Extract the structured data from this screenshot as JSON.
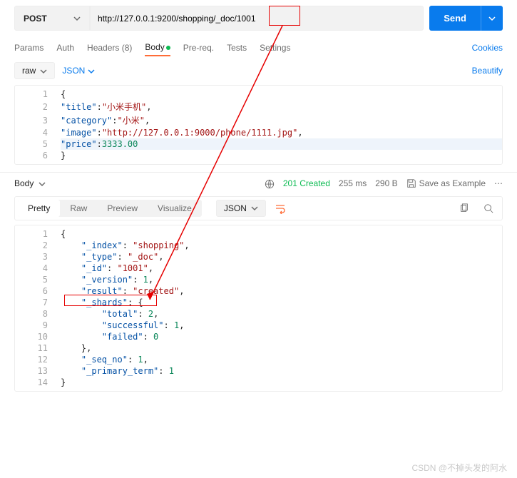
{
  "request": {
    "method": "POST",
    "url": "http://127.0.0.1:9200/shopping/_doc/1001",
    "send_label": "Send"
  },
  "tabs": {
    "params": "Params",
    "auth": "Auth",
    "headers": "Headers (8)",
    "body": "Body",
    "pre": "Pre-req.",
    "tests": "Tests",
    "settings": "Settings",
    "cookies": "Cookies"
  },
  "body_controls": {
    "mode": "raw",
    "lang": "JSON",
    "beautify": "Beautify"
  },
  "request_body_lines": {
    "l1": "{",
    "l2a": "\"title\"",
    "l2b": ":",
    "l2c": "\"小米手机\"",
    "l2d": ",",
    "l3a": "\"category\"",
    "l3b": ":",
    "l3c": "\"小米\"",
    "l3d": ",",
    "l4a": "\"image\"",
    "l4b": ":",
    "l4c": "\"http://127.0.0.1:9000/phone/1111.jpg\"",
    "l4d": ",",
    "l5a": "\"price\"",
    "l5b": ":",
    "l5c": "3333.00",
    "l6": "}"
  },
  "response": {
    "section": "Body",
    "status": "201 Created",
    "time": "255 ms",
    "size": "290 B",
    "save_example": "Save as Example"
  },
  "resp_tabs": {
    "pretty": "Pretty",
    "raw": "Raw",
    "preview": "Preview",
    "visualize": "Visualize",
    "format": "JSON"
  },
  "response_lines": {
    "l1": "{",
    "l2a": "    ",
    "l2b": "\"_index\"",
    "l2c": ": ",
    "l2d": "\"shopping\"",
    "l2e": ",",
    "l3a": "    ",
    "l3b": "\"_type\"",
    "l3c": ": ",
    "l3d": "\"_doc\"",
    "l3e": ",",
    "l4a": "    ",
    "l4b": "\"_id\"",
    "l4c": ": ",
    "l4d": "\"1001\"",
    "l4e": ",",
    "l5a": "    ",
    "l5b": "\"_version\"",
    "l5c": ": ",
    "l5d": "1",
    "l5e": ",",
    "l6a": "    ",
    "l6b": "\"result\"",
    "l6c": ": ",
    "l6d": "\"created\"",
    "l6e": ",",
    "l7a": "    ",
    "l7b": "\"_shards\"",
    "l7c": ": {",
    "l8a": "        ",
    "l8b": "\"total\"",
    "l8c": ": ",
    "l8d": "2",
    "l8e": ",",
    "l9a": "        ",
    "l9b": "\"successful\"",
    "l9c": ": ",
    "l9d": "1",
    "l9e": ",",
    "l10a": "        ",
    "l10b": "\"failed\"",
    "l10c": ": ",
    "l10d": "0",
    "l11a": "    },",
    "l12a": "    ",
    "l12b": "\"_seq_no\"",
    "l12c": ": ",
    "l12d": "1",
    "l12e": ",",
    "l13a": "    ",
    "l13b": "\"_primary_term\"",
    "l13c": ": ",
    "l13d": "1",
    "l14": "}"
  },
  "linenums": {
    "1": "1",
    "2": "2",
    "3": "3",
    "4": "4",
    "5": "5",
    "6": "6",
    "7": "7",
    "8": "8",
    "9": "9",
    "10": "10",
    "11": "11",
    "12": "12",
    "13": "13",
    "14": "14"
  },
  "watermark": "CSDN @不掉头发的阿水"
}
